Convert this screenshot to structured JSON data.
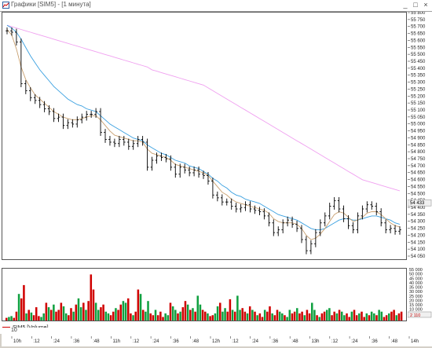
{
  "window": {
    "title": "Графики [SIM5] - [1 минута]",
    "buttons": [
      "_",
      "□",
      "×"
    ]
  },
  "legend": {
    "volume_label": "SIM5 [Volume]"
  },
  "footer": {
    "value": "10"
  },
  "colors": {
    "up": "#10a040",
    "down": "#d00000",
    "ma_fast": "#c8a070",
    "ma_mid": "#3aa0e0",
    "ma_slow": "#f0a0f0",
    "bar": "#000000",
    "marker": "#d02060"
  },
  "chart_data": [
    {
      "type": "line",
      "title": "",
      "ylim": [
        54050,
        55800
      ],
      "y_ticks": [
        55800,
        55750,
        55700,
        55650,
        55600,
        55550,
        55500,
        55450,
        55400,
        55350,
        55300,
        55250,
        55200,
        55150,
        55100,
        55050,
        55000,
        54950,
        54900,
        54850,
        54800,
        54750,
        54700,
        54650,
        54600,
        54550,
        54500,
        54450,
        54400,
        54350,
        54300,
        54250,
        54200,
        54150,
        54100,
        54050
      ],
      "last_price": "54 433",
      "last_price_value": 54433,
      "x_ticks": [
        "10h",
        ":12",
        ":24",
        ":36",
        ":48",
        "11h",
        ":12",
        ":24",
        ":36",
        ":48",
        "12h",
        ":12",
        ":24",
        ":36",
        ":48",
        "13h",
        ":12",
        ":24",
        ":36",
        ":48",
        "14h"
      ],
      "price": [
        55680,
        55670,
        55600,
        55300,
        55250,
        55200,
        55180,
        55150,
        55120,
        55100,
        55050,
        55060,
        55000,
        55020,
        55010,
        55040,
        55060,
        55080,
        55080,
        55100,
        54950,
        54900,
        54880,
        54870,
        54900,
        54880,
        54850,
        54870,
        54900,
        54880,
        54700,
        54750,
        54780,
        54770,
        54760,
        54700,
        54650,
        54700,
        54680,
        54660,
        54680,
        54650,
        54640,
        54600,
        54500,
        54480,
        54450,
        54450,
        54420,
        54400,
        54410,
        54430,
        54400,
        54390,
        54380,
        54350,
        54300,
        54230,
        54250,
        54300,
        54320,
        54290,
        54260,
        54180,
        54100,
        54150,
        54230,
        54300,
        54350,
        54420,
        54460,
        54400,
        54330,
        54280,
        54250,
        54350,
        54400,
        54430,
        54420,
        54380,
        54300,
        54250,
        54260,
        54240,
        54250
      ],
      "ma_fast": [
        55690,
        55650,
        55550,
        55420,
        55330,
        55270,
        55220,
        55190,
        55160,
        55130,
        55100,
        55080,
        55060,
        55050,
        55040,
        55040,
        55050,
        55060,
        55070,
        55070,
        55040,
        55000,
        54960,
        54930,
        54920,
        54910,
        54900,
        54890,
        54890,
        54880,
        54830,
        54800,
        54790,
        54780,
        54770,
        54750,
        54720,
        54710,
        54700,
        54690,
        54680,
        54670,
        54660,
        54640,
        54600,
        54560,
        54520,
        54500,
        54470,
        54450,
        54440,
        54430,
        54420,
        54410,
        54400,
        54390,
        54370,
        54330,
        54310,
        54300,
        54300,
        54300,
        54290,
        54260,
        54210,
        54180,
        54190,
        54220,
        54260,
        54310,
        54360,
        54380,
        54370,
        54340,
        54310,
        54320,
        54340,
        54370,
        54380,
        54380,
        54360,
        54330,
        54300,
        54280,
        54270
      ],
      "ma_mid": [
        55720,
        55700,
        55670,
        55620,
        55560,
        55500,
        55450,
        55400,
        55360,
        55320,
        55280,
        55250,
        55220,
        55190,
        55170,
        55150,
        55140,
        55120,
        55110,
        55100,
        55070,
        55040,
        55010,
        54990,
        54970,
        54950,
        54930,
        54910,
        54900,
        54890,
        54860,
        54840,
        54820,
        54800,
        54790,
        54770,
        54750,
        54740,
        54730,
        54710,
        54700,
        54690,
        54670,
        54650,
        54620,
        54600,
        54570,
        54550,
        54520,
        54500,
        54490,
        54470,
        54460,
        54450,
        54440,
        54420,
        54400,
        54380,
        54360,
        54350,
        54340,
        54330,
        54320,
        54300,
        54280,
        54260,
        54250,
        54250,
        54260,
        54280,
        54300,
        54320,
        54330,
        54330,
        54320,
        54320,
        54330,
        54340,
        54350,
        54350,
        54340,
        54330,
        54320,
        54300,
        54290
      ],
      "ma_slow": [
        55720,
        55710,
        55700,
        55690,
        55680,
        55670,
        55660,
        55650,
        55640,
        55630,
        55620,
        55610,
        55600,
        55590,
        55580,
        55570,
        55560,
        55550,
        55540,
        55530,
        55520,
        55510,
        55500,
        55490,
        55480,
        55470,
        55460,
        55450,
        55440,
        55430,
        55420,
        55400,
        55390,
        55380,
        55370,
        55360,
        55350,
        55340,
        55330,
        55320,
        55310,
        55300,
        55290,
        55270,
        55250,
        55230,
        55210,
        55190,
        55170,
        55150,
        55130,
        55110,
        55090,
        55070,
        55050,
        55030,
        55010,
        54990,
        54970,
        54950,
        54930,
        54910,
        54890,
        54870,
        54850,
        54830,
        54810,
        54790,
        54770,
        54750,
        54730,
        54710,
        54690,
        54670,
        54650,
        54630,
        54610,
        54600,
        54590,
        54580,
        54570,
        54560,
        54550,
        54540,
        54530
      ]
    },
    {
      "type": "bar",
      "title": "",
      "series_name": "SIM5 [Volume]",
      "ylim": [
        0,
        55000
      ],
      "y_ticks": [
        "55 000",
        "50 000",
        "45 000",
        "40 000",
        "35 000",
        "30 000",
        "25 000",
        "20 000",
        "15 000",
        "10 000",
        "5 000"
      ],
      "last_volume": "2 110",
      "values": [
        3,
        4,
        5,
        3,
        10,
        30,
        25,
        40,
        8,
        12,
        9,
        6,
        15,
        5,
        4,
        8,
        20,
        15,
        12,
        18,
        10,
        12,
        20,
        16,
        8,
        6,
        14,
        10,
        18,
        25,
        15,
        20,
        12,
        22,
        52,
        35,
        20,
        12,
        15,
        18,
        10,
        8,
        6,
        10,
        14,
        12,
        18,
        22,
        20,
        25,
        8,
        6,
        10,
        35,
        30,
        12,
        10,
        22,
        8,
        6,
        12,
        6,
        10,
        4,
        8,
        6,
        20,
        16,
        12,
        8,
        10,
        15,
        22,
        18,
        12,
        14,
        10,
        28,
        18,
        12,
        10,
        8,
        5,
        6,
        8,
        16,
        20,
        10,
        14,
        10,
        24,
        12,
        10,
        28,
        12,
        14,
        10,
        8,
        16,
        12,
        10,
        6,
        8,
        4,
        12,
        10,
        16,
        8,
        6,
        12,
        10,
        8,
        6,
        4,
        12,
        8,
        10,
        14,
        8,
        10,
        6,
        12,
        8,
        20,
        12,
        6,
        4,
        8,
        10,
        12,
        14,
        6,
        10,
        8,
        12,
        10,
        6,
        8,
        4,
        10,
        12,
        6,
        8,
        10,
        4,
        8,
        6,
        10,
        8,
        6,
        12,
        10,
        4,
        6,
        8,
        10,
        12,
        6,
        8,
        10
      ],
      "directions": "duudduddududdduudududdduudduduududdduudduuddudduuddudduduudduddduuduududdududuuddudduuduudduduuddudududduddudduuduudduddudduududduudduduudduddudduduuduudduddudduudduduud"
    }
  ]
}
